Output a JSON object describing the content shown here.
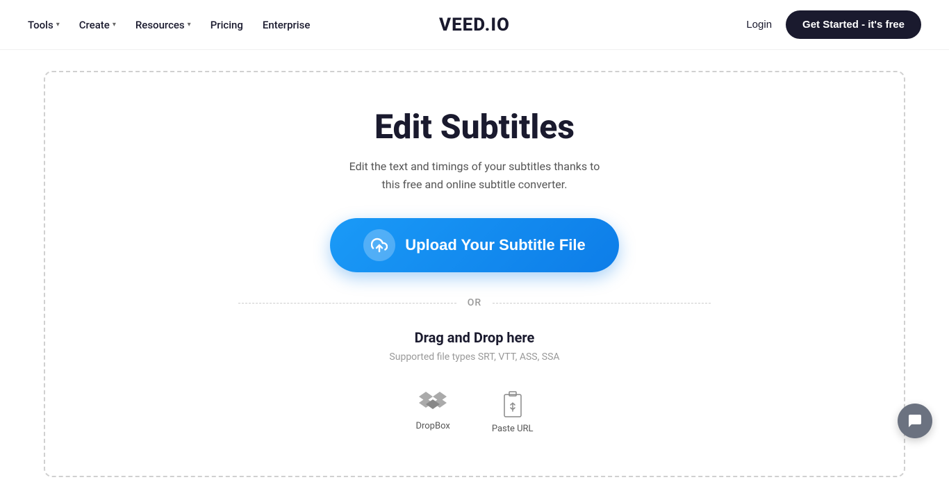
{
  "header": {
    "logo": "VEED.IO",
    "nav": {
      "tools_label": "Tools",
      "create_label": "Create",
      "resources_label": "Resources",
      "pricing_label": "Pricing",
      "enterprise_label": "Enterprise"
    },
    "login_label": "Login",
    "get_started_label": "Get Started - it's free"
  },
  "main": {
    "title": "Edit Subtitles",
    "subtitle_line1": "Edit the text and timings of your subtitles thanks to",
    "subtitle_line2": "this free and online subtitle converter.",
    "upload_btn_label": "Upload Your Subtitle File",
    "or_text": "OR",
    "drag_drop_title": "Drag and Drop here",
    "drag_drop_subtitle": "Supported file types SRT, VTT, ASS, SSA",
    "integrations": [
      {
        "label": "DropBox",
        "icon": "dropbox-icon"
      },
      {
        "label": "Paste URL",
        "icon": "paste-url-icon"
      }
    ]
  }
}
